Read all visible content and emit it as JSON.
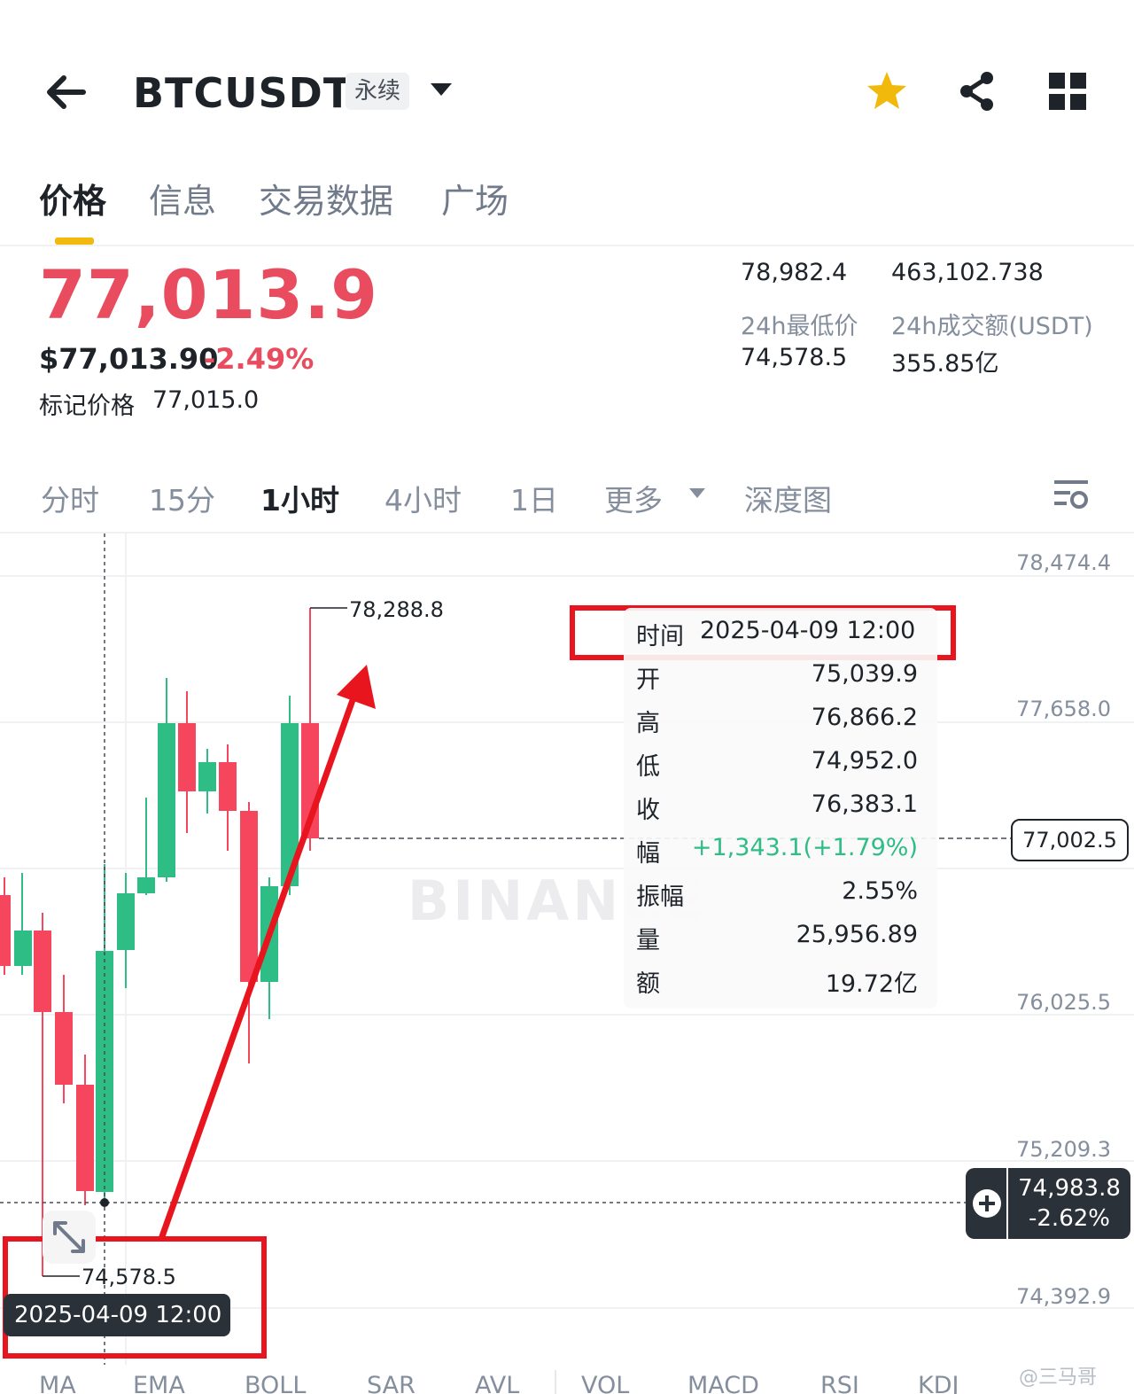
{
  "header": {
    "symbol": "BTCUSDT",
    "contract_type": "永续",
    "icons": [
      "back-arrow-icon",
      "chevron-down-icon",
      "star-icon",
      "share-icon",
      "grid-menu-icon"
    ],
    "star_color": "#f0b90b"
  },
  "tabs": [
    "价格",
    "信息",
    "交易数据",
    "广场"
  ],
  "active_tab": "价格",
  "price": {
    "last_price": "77,013.9",
    "usd_value": "$77,013.90",
    "change_pct": "-2.49%",
    "mark_price_label": "标记价格",
    "mark_price": "77,015.0",
    "high_24h": "78,982.4",
    "volume_24h_btc": "463,102.738",
    "low_24h_label": "24h最低价",
    "low_24h": "74,578.5",
    "turnover_24h_label": "24h成交额(USDT)",
    "turnover_24h": "355.85亿",
    "down_color": "#e84c5e",
    "up_color": "#2ebd85"
  },
  "timeframes": [
    "分时",
    "15分",
    "1小时",
    "4小时",
    "1日",
    "更多",
    "深度图"
  ],
  "active_timeframe": "1小时",
  "chart": {
    "y_axis_labels": [
      "78,474.4",
      "77,658.0",
      "76,025.5",
      "75,209.3",
      "74,392.9"
    ],
    "max_label": "78,288.8",
    "min_label": "74,578.5",
    "last_price_tag": "77,002.5",
    "crosshair_price": "74,983.8",
    "crosshair_pct": "-2.62%",
    "crosshair_time": "2025-04-09 12:00",
    "watermark": "BINANCE"
  },
  "tooltip": {
    "time_label": "时间",
    "time_value": "2025-04-09 12:00",
    "rows": [
      {
        "key": "开",
        "value": "75,039.9"
      },
      {
        "key": "高",
        "value": "76,866.2"
      },
      {
        "key": "低",
        "value": "74,952.0"
      },
      {
        "key": "收",
        "value": "76,383.1"
      },
      {
        "key": "幅",
        "value": "+1,343.1(+1.79%)"
      },
      {
        "key": "振幅",
        "value": "2.55%"
      },
      {
        "key": "量",
        "value": "25,956.89"
      },
      {
        "key": "额",
        "value": "19.72亿"
      }
    ]
  },
  "indicators": [
    "MA",
    "EMA",
    "BOLL",
    "SAR",
    "AVL",
    "VOL",
    "MACD",
    "RSI",
    "KDJ"
  ],
  "corner_mark": "@三马哥"
}
